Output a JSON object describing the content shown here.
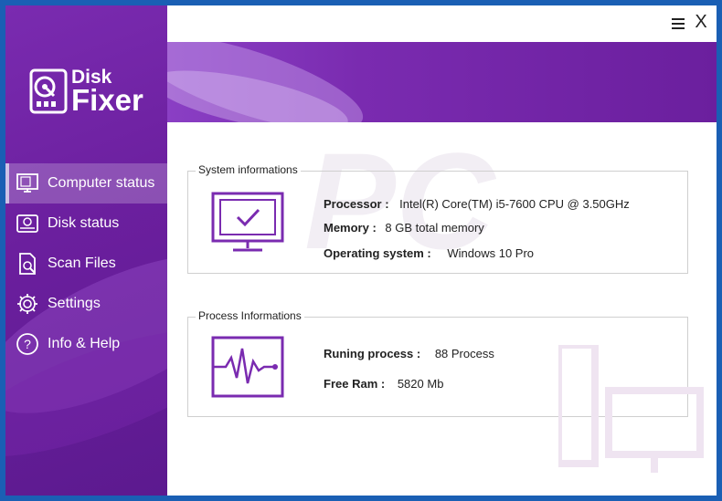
{
  "app": {
    "logo_line1": "Disk",
    "logo_line2": "Fixer",
    "accent": "#7a2bb0",
    "frame_color": "#1a5fb4"
  },
  "window_controls": {
    "menu_icon": "hamburger-icon",
    "close_label": "X"
  },
  "sidebar": {
    "items": [
      {
        "label": "Computer status",
        "icon": "monitor-icon",
        "active": true
      },
      {
        "label": "Disk status",
        "icon": "disk-icon",
        "active": false
      },
      {
        "label": "Scan Files",
        "icon": "file-search-icon",
        "active": false
      },
      {
        "label": "Settings",
        "icon": "gear-icon",
        "active": false
      },
      {
        "label": "Info & Help",
        "icon": "question-icon",
        "active": false
      }
    ]
  },
  "system_info": {
    "title": "System informations",
    "processor_label": "Processor :",
    "processor_value": "Intel(R) Core(TM) i5-7600 CPU @ 3.50GHz",
    "memory_label": "Memory :",
    "memory_value": "8 GB total memory",
    "os_label": "Operating system :",
    "os_value": "Windows 10 Pro"
  },
  "process_info": {
    "title": "Process Informations",
    "running_label": "Runing process :",
    "running_value": "88  Process",
    "ram_label": "Free Ram :",
    "ram_value": "5820  Mb"
  }
}
